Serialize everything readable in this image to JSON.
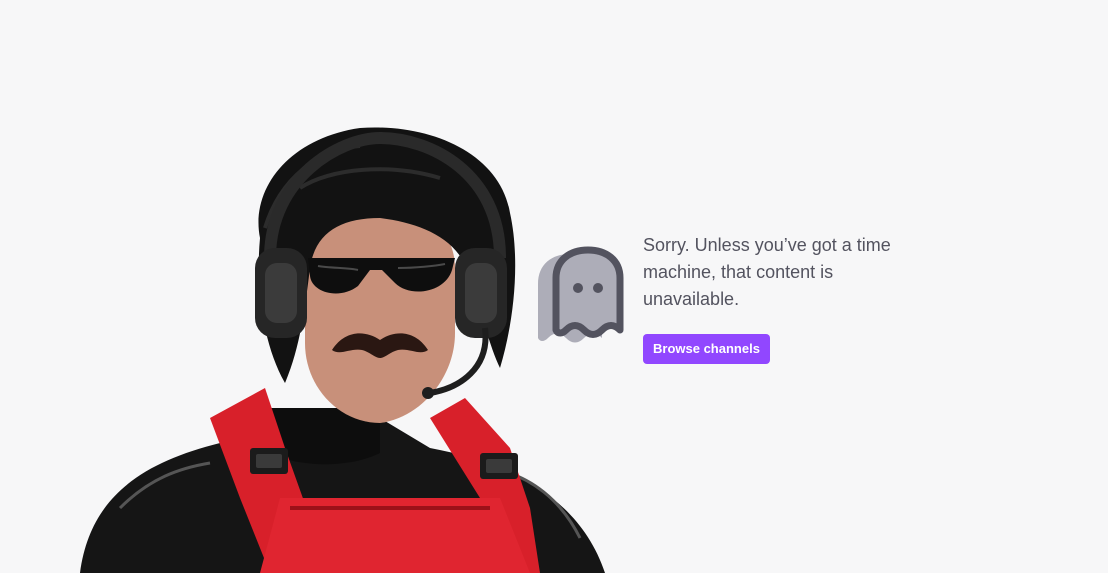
{
  "error": {
    "message": "Sorry. Unless you’ve got a time machine, that content is unavailable.",
    "browse_button_label": "Browse channels"
  },
  "icons": {
    "ghost": "ghost-icon"
  },
  "colors": {
    "background": "#f7f7f8",
    "accent": "#9147ff",
    "text": "#53535f",
    "ghost_outline": "#53535f",
    "ghost_fill": "#adadb8"
  }
}
